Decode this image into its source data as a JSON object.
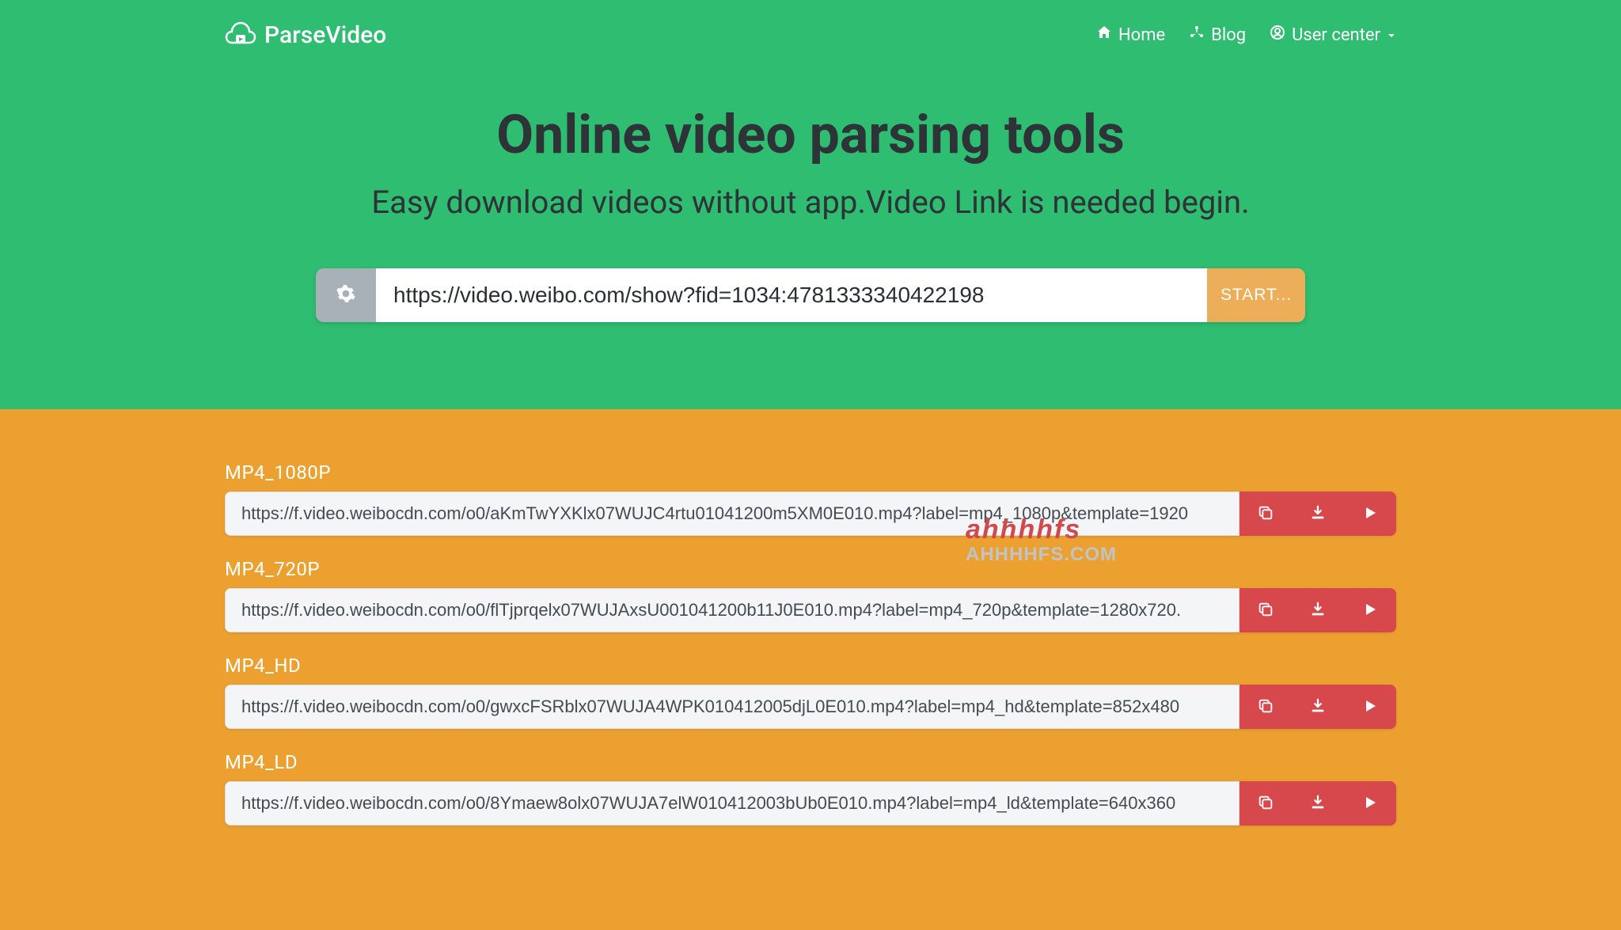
{
  "brand": {
    "name": "ParseVideo"
  },
  "nav": {
    "home": "Home",
    "blog": "Blog",
    "user_center": "User center"
  },
  "hero": {
    "title": "Online video parsing tools",
    "subtitle": "Easy download videos without app.Video Link is needed begin.",
    "input_value": "https://video.weibo.com/show?fid=1034:4781333340422198",
    "start_label": "START..."
  },
  "results": [
    {
      "label": "MP4_1080P",
      "url": "https://f.video.weibocdn.com/o0/aKmTwYXKlx07WUJC4rtu01041200m5XM0E010.mp4?label=mp4_1080p&template=1920"
    },
    {
      "label": "MP4_720P",
      "url": "https://f.video.weibocdn.com/o0/flTjprqelx07WUJAxsU001041200b11J0E010.mp4?label=mp4_720p&template=1280x720."
    },
    {
      "label": "MP4_HD",
      "url": "https://f.video.weibocdn.com/o0/gwxcFSRblx07WUJA4WPK010412005djL0E010.mp4?label=mp4_hd&template=852x480"
    },
    {
      "label": "MP4_LD",
      "url": "https://f.video.weibocdn.com/o0/8Ymaew8olx07WUJA7elW010412003bUb0E010.mp4?label=mp4_ld&template=640x360"
    }
  ],
  "watermark": {
    "line1": "ahhhhfs",
    "line2": "AHHHHFS.COM"
  },
  "colors": {
    "hero_bg": "#2ebd71",
    "results_bg": "#eca030",
    "action_bg": "#d6484b",
    "start_bg": "#edae59"
  }
}
